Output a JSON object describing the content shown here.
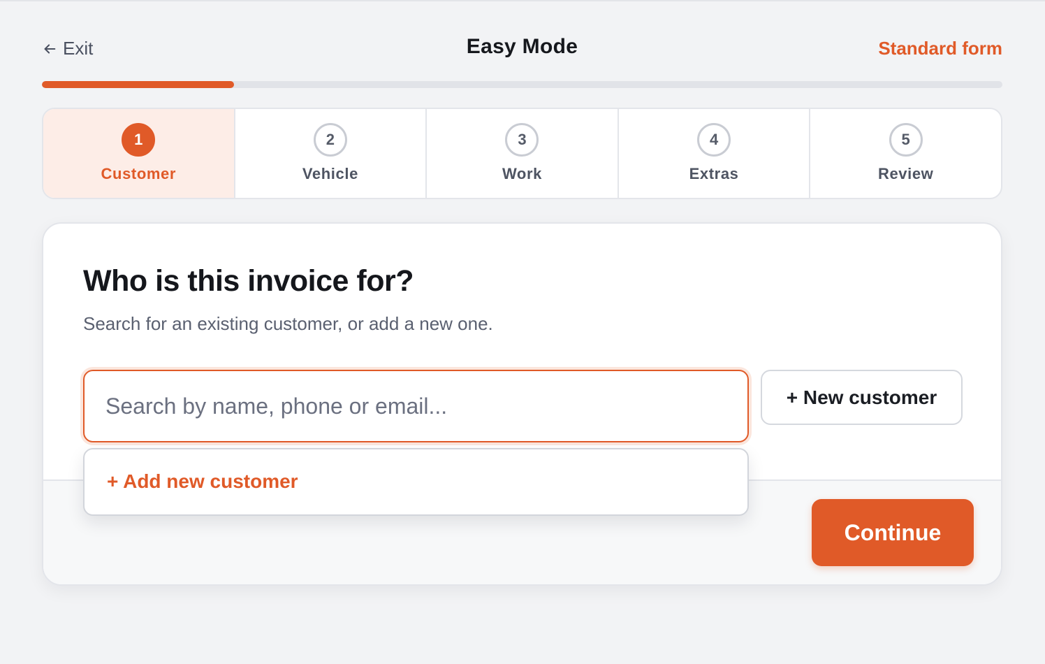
{
  "header": {
    "exit_label": "Exit",
    "title": "Easy Mode",
    "standard_form_label": "Standard form"
  },
  "progress": {
    "fraction": 0.2
  },
  "steps": [
    {
      "number": "1",
      "label": "Customer",
      "active": true
    },
    {
      "number": "2",
      "label": "Vehicle",
      "active": false
    },
    {
      "number": "3",
      "label": "Work",
      "active": false
    },
    {
      "number": "4",
      "label": "Extras",
      "active": false
    },
    {
      "number": "5",
      "label": "Review",
      "active": false
    }
  ],
  "main": {
    "heading": "Who is this invoice for?",
    "subheading": "Search for an existing customer, or add a new one.",
    "search": {
      "placeholder": "Search by name, phone or email...",
      "value": ""
    },
    "new_customer_label": "+ New customer",
    "dropdown": {
      "add_new_label": "+ Add new customer"
    },
    "continue_label": "Continue"
  },
  "colors": {
    "accent": "#e05a28",
    "accent_light": "#fdede7",
    "background": "#f2f3f5"
  },
  "icons": {
    "exit": "arrow-left-icon"
  }
}
